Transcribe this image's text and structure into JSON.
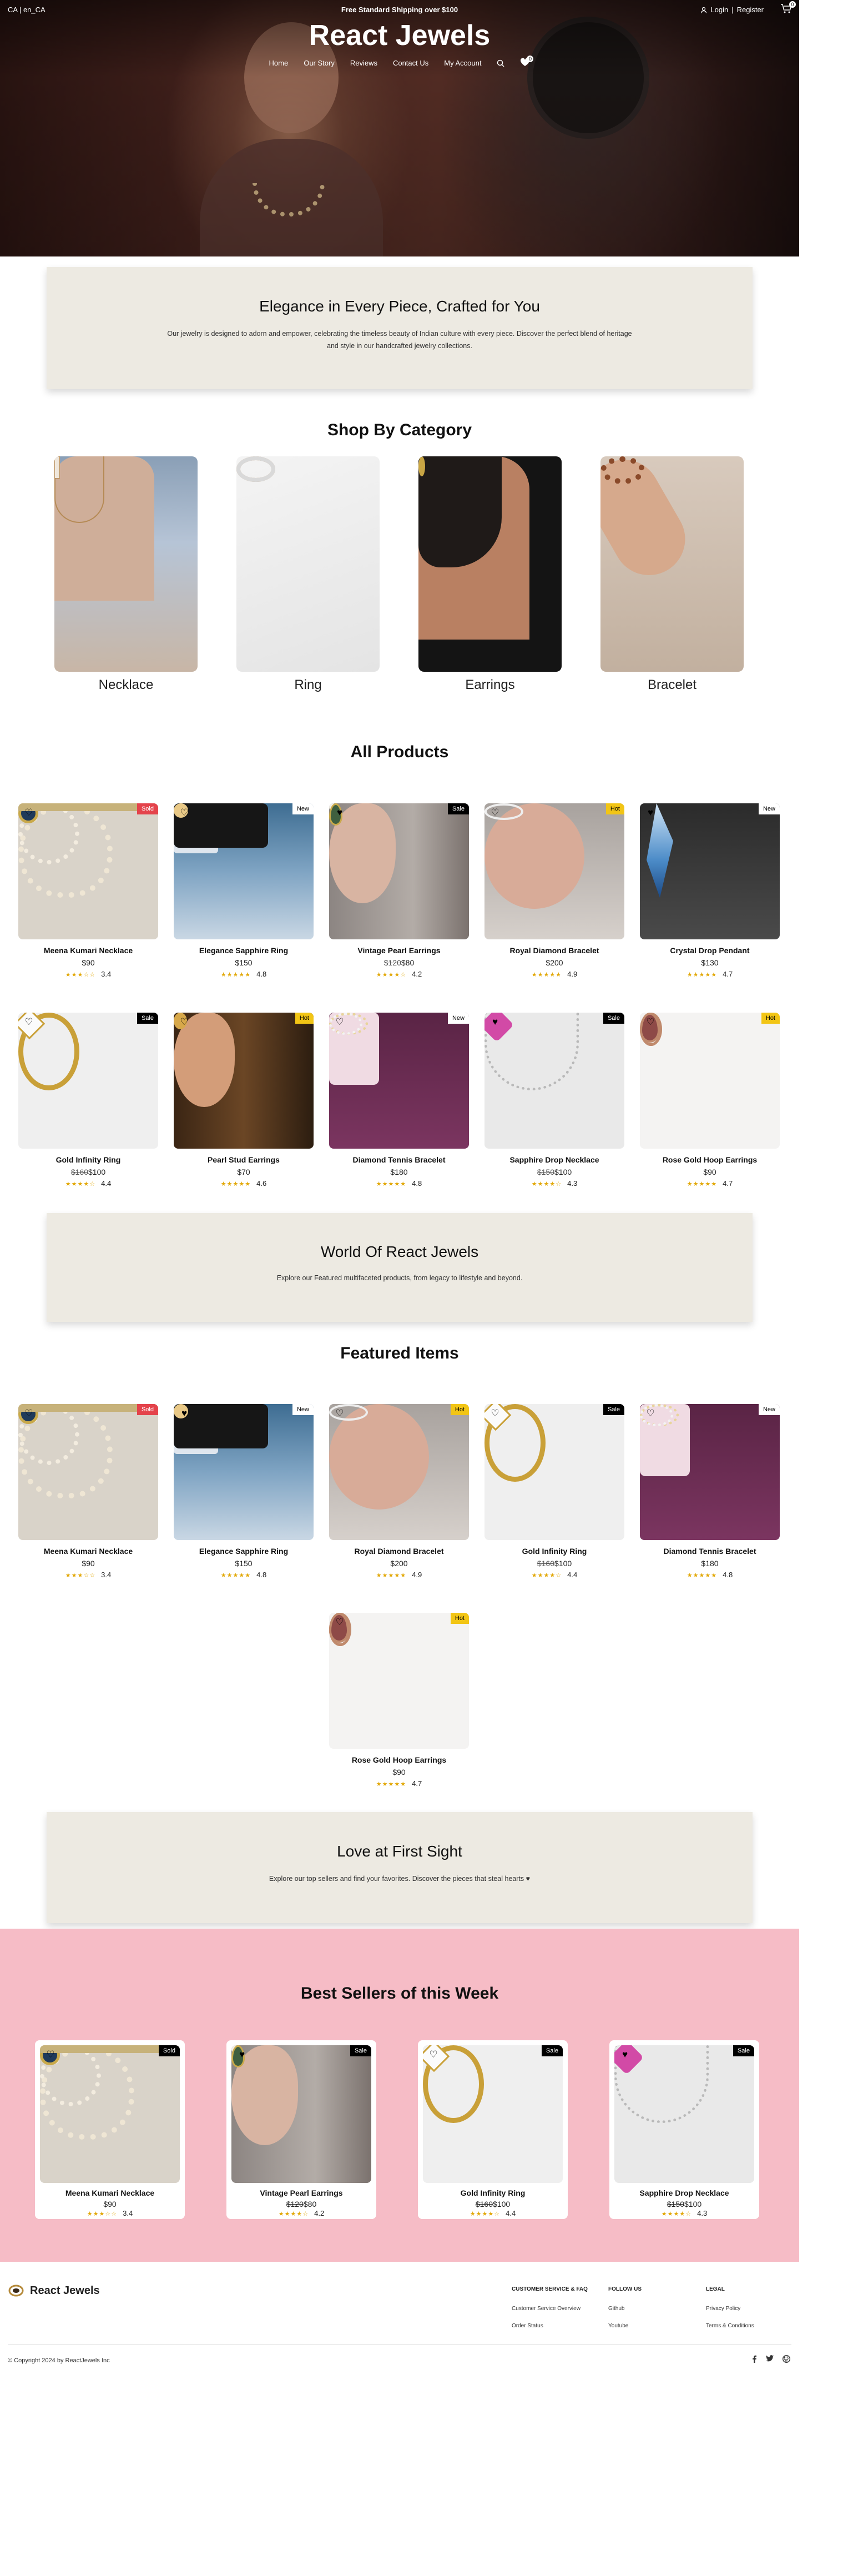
{
  "topbar": {
    "locale": "CA | en_CA",
    "shipping": "Free Standard Shipping over $100",
    "login": "Login",
    "separator": "|",
    "register": "Register",
    "cart_count": "0"
  },
  "brand": {
    "name": "React Jewels"
  },
  "nav": {
    "items": [
      "Home",
      "Our Story",
      "Reviews",
      "Contact Us",
      "My Account"
    ],
    "wishlist_count": "0"
  },
  "intro": {
    "title": "Elegance in Every Piece, Crafted for You",
    "text": "Our jewelry is designed to adorn and empower, celebrating the timeless beauty of Indian culture with every piece. Discover the perfect blend of heritage and style in our handcrafted jewelry collections."
  },
  "categories": {
    "title": "Shop By Category",
    "items": [
      {
        "label": "Necklace"
      },
      {
        "label": "Ring"
      },
      {
        "label": "Earrings"
      },
      {
        "label": "Bracelet"
      }
    ]
  },
  "all_products": {
    "title": "All Products",
    "items": [
      {
        "name": "Meena Kumari Necklace",
        "price": "$90",
        "old_price": "",
        "rating": "3.4",
        "stars": "★★★☆☆",
        "tag": "Sold"
      },
      {
        "name": "Elegance Sapphire Ring",
        "price": "$150",
        "old_price": "",
        "rating": "4.8",
        "stars": "★★★★★",
        "tag": "New"
      },
      {
        "name": "Vintage Pearl Earrings",
        "price": "$80",
        "old_price": "$120",
        "rating": "4.2",
        "stars": "★★★★☆",
        "tag": "Sale"
      },
      {
        "name": "Royal Diamond Bracelet",
        "price": "$200",
        "old_price": "",
        "rating": "4.9",
        "stars": "★★★★★",
        "tag": "Hot"
      },
      {
        "name": "Crystal Drop Pendant",
        "price": "$130",
        "old_price": "",
        "rating": "4.7",
        "stars": "★★★★★",
        "tag": "New"
      },
      {
        "name": "Gold Infinity Ring",
        "price": "$100",
        "old_price": "$160",
        "rating": "4.4",
        "stars": "★★★★☆",
        "tag": "Sale"
      },
      {
        "name": "Pearl Stud Earrings",
        "price": "$70",
        "old_price": "",
        "rating": "4.6",
        "stars": "★★★★★",
        "tag": "Hot"
      },
      {
        "name": "Diamond Tennis Bracelet",
        "price": "$180",
        "old_price": "",
        "rating": "4.8",
        "stars": "★★★★★",
        "tag": "New"
      },
      {
        "name": "Sapphire Drop Necklace",
        "price": "$100",
        "old_price": "$150",
        "rating": "4.3",
        "stars": "★★★★☆",
        "tag": "Sale"
      },
      {
        "name": "Rose Gold Hoop Earrings",
        "price": "$90",
        "old_price": "",
        "rating": "4.7",
        "stars": "★★★★★",
        "tag": "Hot"
      }
    ]
  },
  "world": {
    "title": "World Of React Jewels",
    "text": "Explore our Featured multifaceted products, from legacy to lifestyle and beyond."
  },
  "featured": {
    "title": "Featured Items",
    "items": [
      {
        "name": "Meena Kumari Necklace",
        "price": "$90",
        "old_price": "",
        "rating": "3.4",
        "stars": "★★★☆☆",
        "tag": "Sold"
      },
      {
        "name": "Elegance Sapphire Ring",
        "price": "$150",
        "old_price": "",
        "rating": "4.8",
        "stars": "★★★★★",
        "tag": "New"
      },
      {
        "name": "Royal Diamond Bracelet",
        "price": "$200",
        "old_price": "",
        "rating": "4.9",
        "stars": "★★★★★",
        "tag": "Hot"
      },
      {
        "name": "Gold Infinity Ring",
        "price": "$100",
        "old_price": "$160",
        "rating": "4.4",
        "stars": "★★★★☆",
        "tag": "Sale"
      },
      {
        "name": "Diamond Tennis Bracelet",
        "price": "$180",
        "old_price": "",
        "rating": "4.8",
        "stars": "★★★★★",
        "tag": "New"
      },
      {
        "name": "Rose Gold Hoop Earrings",
        "price": "$90",
        "old_price": "",
        "rating": "4.7",
        "stars": "★★★★★",
        "tag": "Hot"
      }
    ]
  },
  "love": {
    "title": "Love at First Sight",
    "text": "Explore our top sellers and find your favorites. Discover the pieces that steal hearts ♥"
  },
  "best_sellers": {
    "title": "Best Sellers of this Week",
    "background": "#f6bcc6",
    "items": [
      {
        "name": "Meena Kumari Necklace",
        "price": "$90",
        "old_price": "",
        "rating": "3.4",
        "stars": "★★★☆☆",
        "tag": "Sold"
      },
      {
        "name": "Vintage Pearl Earrings",
        "price": "$80",
        "old_price": "$120",
        "rating": "4.2",
        "stars": "★★★★☆",
        "tag": "Sale"
      },
      {
        "name": "Gold Infinity Ring",
        "price": "$100",
        "old_price": "$160",
        "rating": "4.4",
        "stars": "★★★★☆",
        "tag": "Sale"
      },
      {
        "name": "Sapphire Drop Necklace",
        "price": "$100",
        "old_price": "$150",
        "rating": "4.3",
        "stars": "★★★★☆",
        "tag": "Sale"
      }
    ]
  },
  "footer": {
    "brand": "React Jewels",
    "col1": {
      "title": "CUSTOMER SERVICE & FAQ",
      "links": [
        "Customer Service Overview",
        "Order Status"
      ]
    },
    "col2": {
      "title": "FOLLOW US",
      "links": [
        "Github",
        "Youtube"
      ]
    },
    "col3": {
      "title": "LEGAL",
      "links": [
        "Privacy Policy",
        "Terms & Conditions"
      ]
    },
    "copyright": "© Copyright 2024 by ReactJewels Inc",
    "social_icons": [
      "facebook-icon",
      "twitter-icon",
      "github-icon"
    ]
  },
  "colors": {
    "sold": "#e4434b",
    "hot": "#f2c515",
    "sale": "#000000",
    "banner": "#edeae2",
    "star": "#e2a808"
  }
}
